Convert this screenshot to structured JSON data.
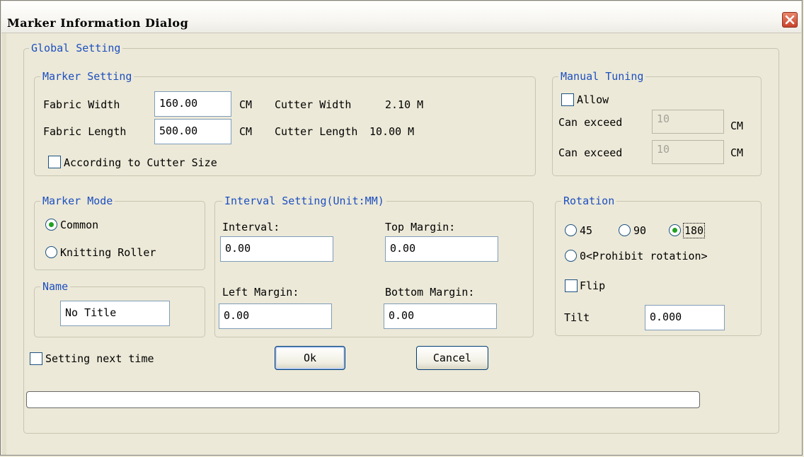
{
  "window": {
    "title": "Marker Information Dialog",
    "close_icon": "close-icon"
  },
  "global": {
    "legend": "Global Setting"
  },
  "marker_setting": {
    "legend": "Marker Setting",
    "fabric_width_label": "Fabric Width",
    "fabric_width_value": "160.00",
    "fabric_width_unit": "CM",
    "fabric_length_label": "Fabric Length",
    "fabric_length_value": "500.00",
    "fabric_length_unit": "CM",
    "cutter_width_label": "Cutter Width",
    "cutter_width_value": "2.10 M",
    "cutter_length_label": "Cutter Length",
    "cutter_length_value": "10.00 M",
    "according_label": "According to Cutter Size",
    "according_checked": false
  },
  "manual_tuning": {
    "legend": "Manual Tuning",
    "allow_label": "Allow",
    "allow_checked": false,
    "exceed1_label": "Can exceed",
    "exceed1_value": "10",
    "exceed1_unit": "CM",
    "exceed2_label": "Can exceed",
    "exceed2_value": "10",
    "exceed2_unit": "CM"
  },
  "marker_mode": {
    "legend": "Marker Mode",
    "options": [
      {
        "label": "Common",
        "selected": true
      },
      {
        "label": "Knitting Roller",
        "selected": false
      }
    ]
  },
  "name": {
    "legend": "Name",
    "value": "No Title"
  },
  "interval": {
    "legend": "Interval Setting(Unit:MM)",
    "interval_label": "Interval:",
    "interval_value": "0.00",
    "top_label": "Top Margin:",
    "top_value": "0.00",
    "left_label": "Left Margin:",
    "left_value": "0.00",
    "bottom_label": "Bottom Margin:",
    "bottom_value": "0.00"
  },
  "rotation": {
    "legend": "Rotation",
    "options": [
      {
        "label": "45",
        "selected": false
      },
      {
        "label": "90",
        "selected": false
      },
      {
        "label": "180",
        "selected": true
      },
      {
        "label": "0<Prohibit rotation>",
        "selected": false
      }
    ],
    "flip_label": "Flip",
    "flip_checked": false,
    "tilt_label": "Tilt",
    "tilt_value": "0.000"
  },
  "footer": {
    "setting_next_label": "Setting next time",
    "setting_next_checked": false,
    "ok_label": "Ok",
    "cancel_label": "Cancel",
    "progress": 0
  },
  "colors": {
    "legend_blue": "#1d4fbf",
    "dialog_bg": "#ece9d8",
    "radio_dot": "#21a121",
    "close_red": "#c8432b"
  }
}
